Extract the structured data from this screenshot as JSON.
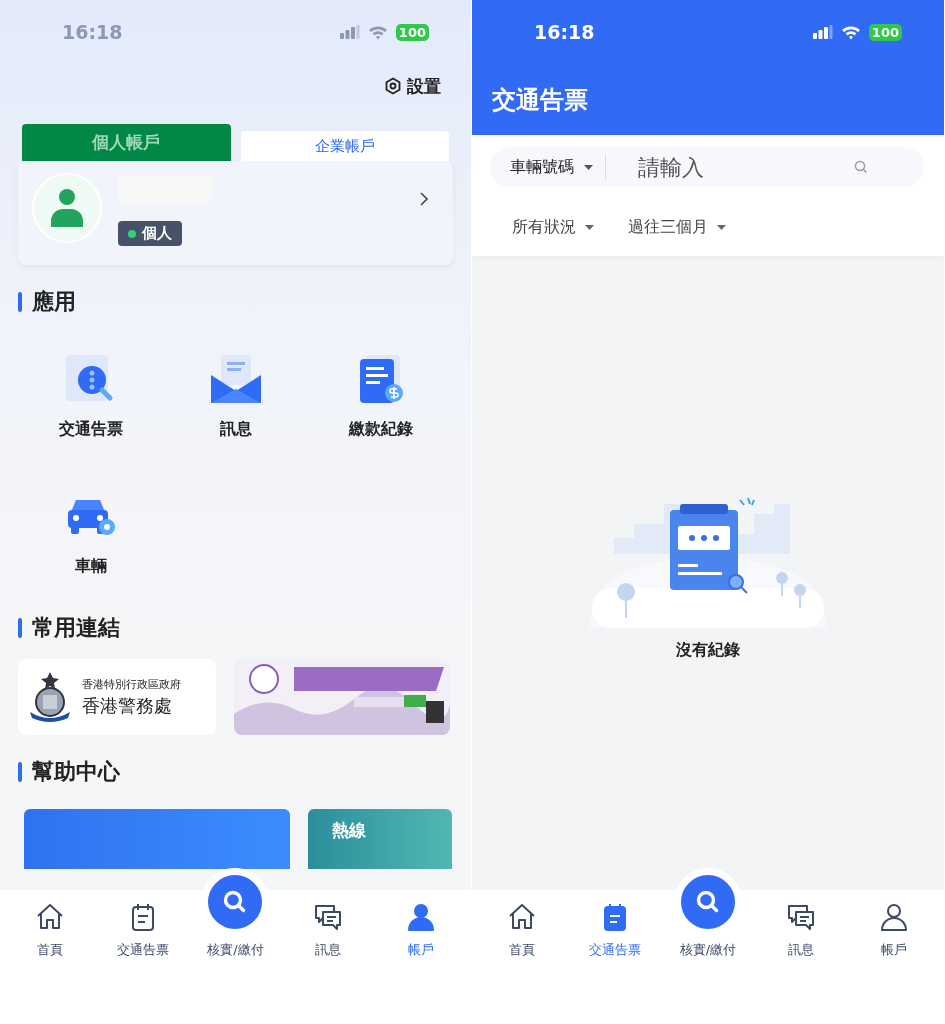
{
  "account_screen": {
    "status_bar": {
      "time": "16:18",
      "battery": "100"
    },
    "settings": "設置",
    "account_tabs": [
      {
        "label": "個人帳戶",
        "selected": true
      },
      {
        "label": "企業帳戶",
        "selected": false
      }
    ],
    "profile": {
      "badge": "個人"
    },
    "sections": [
      {
        "title": "應用",
        "kind": "apps",
        "items": [
          {
            "label": "交通告票",
            "kind": "ticket"
          },
          {
            "label": "訊息",
            "kind": "mail"
          },
          {
            "label": "繳款紀錄",
            "kind": "receipt"
          },
          {
            "label": "車輛",
            "kind": "car"
          }
        ]
      },
      {
        "title": "常用連結",
        "kind": "links",
        "items": [
          {
            "kind": "logo",
            "lines": [
              "香港特別行政區政府",
              "香港警務處"
            ]
          },
          {
            "kind": "picture"
          }
        ]
      },
      {
        "title": "幫助中心",
        "kind": "help",
        "items": [
          {
            "kind": "blue"
          },
          {
            "kind": "teal",
            "label": "熱線"
          }
        ]
      }
    ],
    "nav": [
      {
        "label": "首頁",
        "kind": "home",
        "selected": false
      },
      {
        "label": "交通告票",
        "kind": "ticket",
        "selected": false
      },
      {
        "label": "核實/繳付",
        "kind": "search",
        "selected": false
      },
      {
        "label": "訊息",
        "kind": "chat",
        "selected": false
      },
      {
        "label": "帳戶",
        "kind": "user",
        "selected": true
      }
    ]
  },
  "tickets_screen": {
    "status_bar": {
      "time": "16:18",
      "battery": "100"
    },
    "title": "交通告票",
    "search": {
      "type": "車輛號碼",
      "placeholder": "請輸入"
    },
    "filters": [
      "所有狀況",
      "過往三個月"
    ],
    "empty": "沒有紀錄",
    "nav": [
      {
        "label": "首頁",
        "kind": "home",
        "selected": false
      },
      {
        "label": "交通告票",
        "kind": "ticket",
        "selected": true
      },
      {
        "label": "核實/繳付",
        "kind": "search",
        "selected": false
      },
      {
        "label": "訊息",
        "kind": "chat",
        "selected": false
      },
      {
        "label": "帳戶",
        "kind": "user",
        "selected": false
      }
    ]
  }
}
